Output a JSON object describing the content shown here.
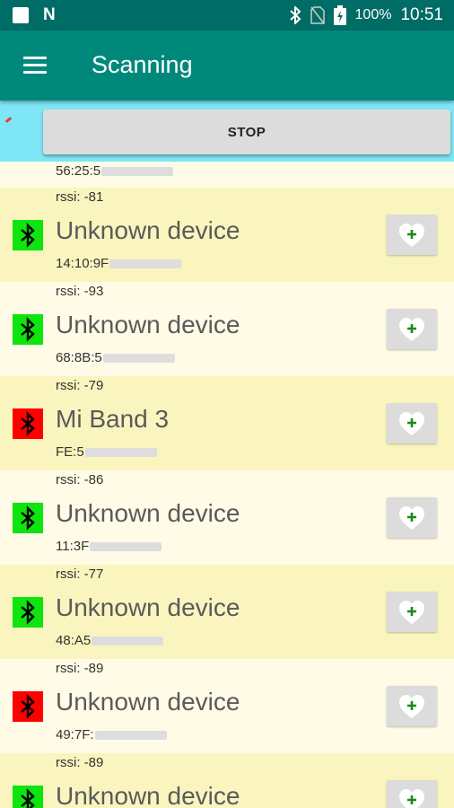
{
  "status_bar": {
    "battery": "100%",
    "time": "10:51",
    "icons": [
      "square-notification-icon",
      "nfc-icon",
      "bluetooth-icon",
      "no-sim-icon",
      "battery-icon"
    ]
  },
  "toolbar": {
    "title": "Scanning",
    "menu_icon": "hamburger-menu-icon"
  },
  "scan": {
    "button_label": "STOP"
  },
  "partial_row": {
    "address": "56:25:5"
  },
  "devices": [
    {
      "rssi": "rssi: -81",
      "name": "Unknown device",
      "address": "14:10:9F",
      "status": "green",
      "bt_icon": "bluetooth-icon",
      "fav_icon": "heart-add-icon"
    },
    {
      "rssi": "rssi: -93",
      "name": "Unknown device",
      "address": "68:8B:5",
      "status": "green",
      "bt_icon": "bluetooth-icon",
      "fav_icon": "heart-add-icon"
    },
    {
      "rssi": "rssi: -79",
      "name": "Mi Band 3",
      "address": "FE:5",
      "status": "red",
      "bt_icon": "bluetooth-icon",
      "fav_icon": "heart-add-icon"
    },
    {
      "rssi": "rssi: -86",
      "name": "Unknown device",
      "address": "11:3F",
      "status": "green",
      "bt_icon": "bluetooth-icon",
      "fav_icon": "heart-add-icon"
    },
    {
      "rssi": "rssi: -77",
      "name": "Unknown device",
      "address": "48:A5",
      "status": "green",
      "bt_icon": "bluetooth-icon",
      "fav_icon": "heart-add-icon"
    },
    {
      "rssi": "rssi: -89",
      "name": "Unknown device",
      "address": "49:7F:",
      "status": "red",
      "bt_icon": "bluetooth-icon",
      "fav_icon": "heart-add-icon"
    },
    {
      "rssi": "rssi: -89",
      "name": "Unknown device",
      "address": "",
      "status": "green",
      "bt_icon": "bluetooth-icon",
      "fav_icon": "heart-add-icon"
    }
  ],
  "colors": {
    "status_bar": "#006c66",
    "toolbar": "#00897b",
    "scan_bar": "#7fe6f5",
    "row_alt_a": "#faf5be",
    "row_alt_b": "#fffbe6",
    "status_green": "#0ee40e",
    "status_red": "#ff0000",
    "plus_green": "#1b8a1b"
  }
}
